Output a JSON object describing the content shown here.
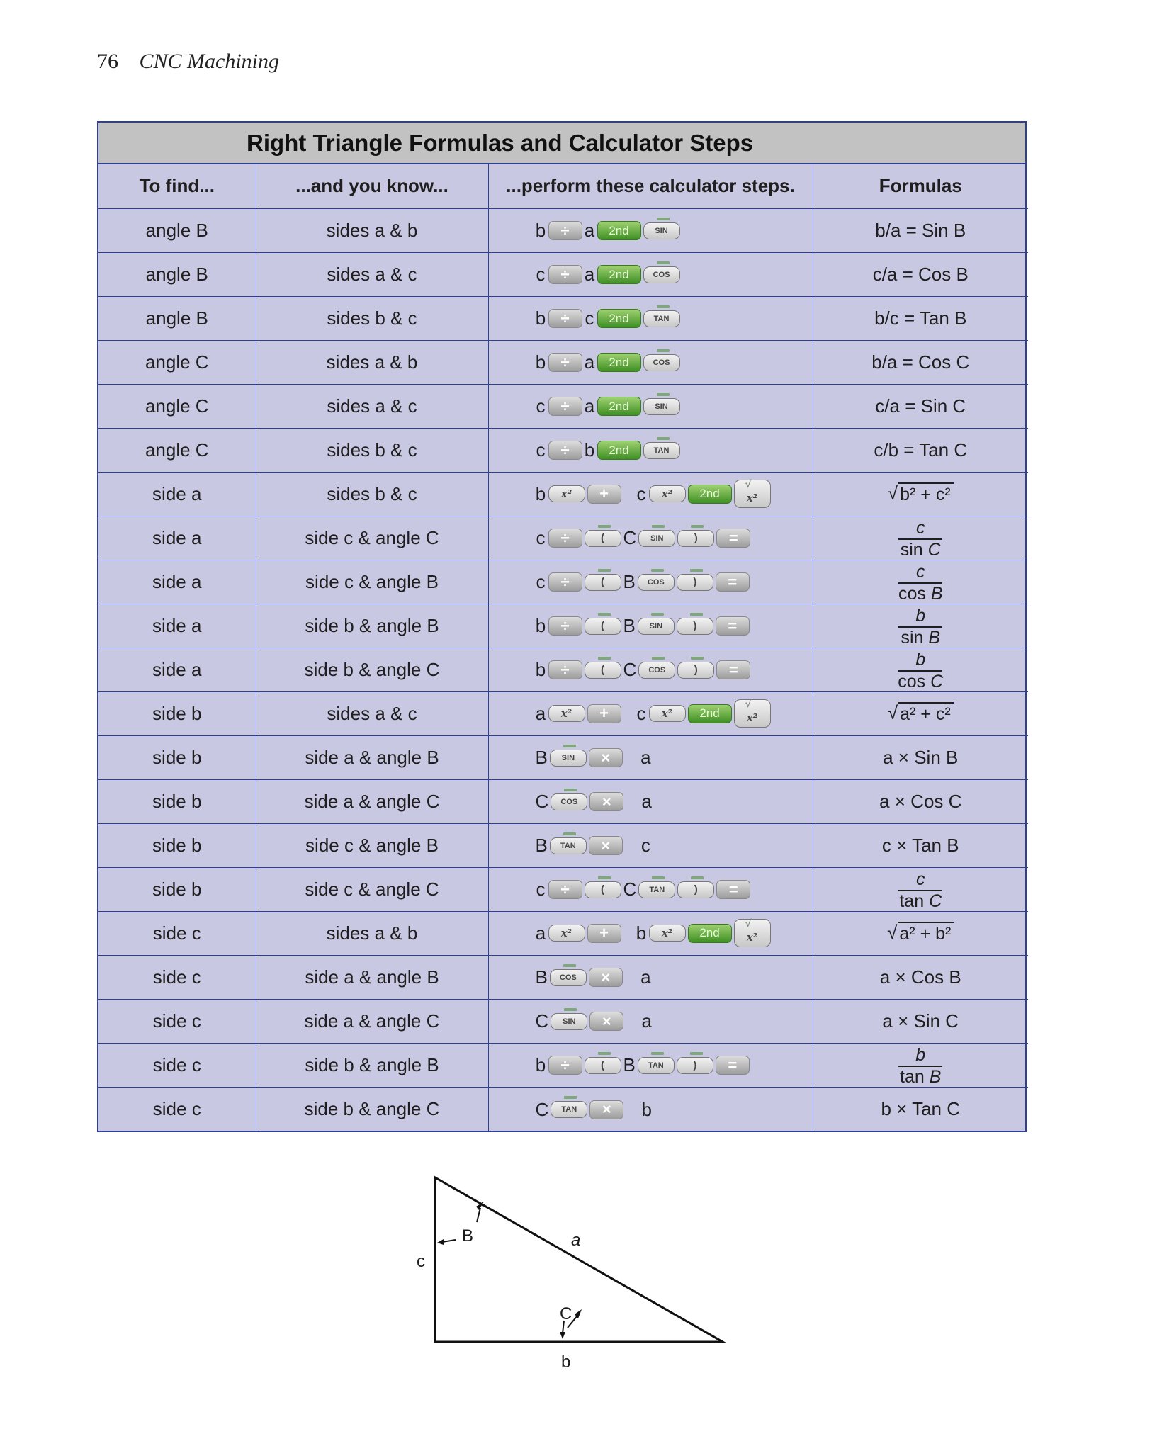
{
  "running_head": {
    "page_number": "76",
    "book_title": "CNC Machining"
  },
  "table": {
    "title": "Right Triangle Formulas and Calculator Steps",
    "headers": [
      "To find...",
      "...and you know...",
      "...perform these calculator steps.",
      "Formulas"
    ],
    "rows": [
      {
        "find": "angle B",
        "know": "sides a & b",
        "steps": [
          [
            "t",
            "b"
          ],
          [
            "div",
            "÷"
          ],
          [
            "t",
            "a"
          ],
          [
            "2nd",
            "2nd"
          ],
          [
            "fn",
            "SIN"
          ]
        ],
        "formula": {
          "type": "text",
          "text": "b/a = Sin B"
        }
      },
      {
        "find": "angle B",
        "know": "sides a & c",
        "steps": [
          [
            "t",
            "c"
          ],
          [
            "div",
            "÷"
          ],
          [
            "t",
            "a"
          ],
          [
            "2nd",
            "2nd"
          ],
          [
            "fn",
            "COS"
          ]
        ],
        "formula": {
          "type": "text",
          "text": "c/a = Cos B"
        }
      },
      {
        "find": "angle B",
        "know": "sides b & c",
        "steps": [
          [
            "t",
            "b"
          ],
          [
            "div",
            "÷"
          ],
          [
            "t",
            "c"
          ],
          [
            "2nd",
            "2nd"
          ],
          [
            "fn",
            "TAN"
          ]
        ],
        "formula": {
          "type": "text",
          "text": "b/c = Tan B"
        }
      },
      {
        "find": "angle C",
        "know": "sides a & b",
        "steps": [
          [
            "t",
            "b"
          ],
          [
            "div",
            "÷"
          ],
          [
            "t",
            "a"
          ],
          [
            "2nd",
            "2nd"
          ],
          [
            "fn",
            "COS"
          ]
        ],
        "formula": {
          "type": "text",
          "text": "b/a = Cos C"
        }
      },
      {
        "find": "angle C",
        "know": "sides a & c",
        "steps": [
          [
            "t",
            "c"
          ],
          [
            "div",
            "÷"
          ],
          [
            "t",
            "a"
          ],
          [
            "2nd",
            "2nd"
          ],
          [
            "fn",
            "SIN"
          ]
        ],
        "formula": {
          "type": "text",
          "text": "c/a = Sin C"
        }
      },
      {
        "find": "angle C",
        "know": "sides b & c",
        "steps": [
          [
            "t",
            "c"
          ],
          [
            "div",
            "÷"
          ],
          [
            "t",
            "b"
          ],
          [
            "2nd",
            "2nd"
          ],
          [
            "fn",
            "TAN"
          ]
        ],
        "formula": {
          "type": "text",
          "text": "c/b = Tan C"
        }
      },
      {
        "find": "side a",
        "know": "sides b & c",
        "steps": [
          [
            "t",
            "b"
          ],
          [
            "sq",
            "x²"
          ],
          [
            "plus",
            "+"
          ],
          [
            "t",
            "c"
          ],
          [
            "sq",
            "x²"
          ],
          [
            "2nd",
            "2nd"
          ],
          [
            "sqrtkey",
            "x²"
          ]
        ],
        "formula": {
          "type": "sqrt",
          "text": "b² + c²"
        }
      },
      {
        "find": "side a",
        "know": "side c & angle C",
        "steps": [
          [
            "t",
            "c"
          ],
          [
            "div",
            "÷"
          ],
          [
            "lp",
            "("
          ],
          [
            "t",
            "C"
          ],
          [
            "fn",
            "SIN"
          ],
          [
            "rp",
            ")"
          ],
          [
            "eq",
            "="
          ]
        ],
        "formula": {
          "type": "frac",
          "num": "c",
          "den_fn": "sin",
          "den_var": "C"
        }
      },
      {
        "find": "side a",
        "know": "side c & angle B",
        "steps": [
          [
            "t",
            "c"
          ],
          [
            "div",
            "÷"
          ],
          [
            "lp",
            "("
          ],
          [
            "t",
            "B"
          ],
          [
            "fn",
            "COS"
          ],
          [
            "rp",
            ")"
          ],
          [
            "eq",
            "="
          ]
        ],
        "formula": {
          "type": "frac",
          "num": "c",
          "den_fn": "cos",
          "den_var": "B"
        }
      },
      {
        "find": "side a",
        "know": "side b & angle B",
        "steps": [
          [
            "t",
            "b"
          ],
          [
            "div",
            "÷"
          ],
          [
            "lp",
            "("
          ],
          [
            "t",
            "B"
          ],
          [
            "fn",
            "SIN"
          ],
          [
            "rp",
            ")"
          ],
          [
            "eq",
            "="
          ]
        ],
        "formula": {
          "type": "frac",
          "num": "b",
          "den_fn": "sin",
          "den_var": "B"
        }
      },
      {
        "find": "side a",
        "know": "side b & angle C",
        "steps": [
          [
            "t",
            "b"
          ],
          [
            "div",
            "÷"
          ],
          [
            "lp",
            "("
          ],
          [
            "t",
            "C"
          ],
          [
            "fn",
            "COS"
          ],
          [
            "rp",
            ")"
          ],
          [
            "eq",
            "="
          ]
        ],
        "formula": {
          "type": "frac",
          "num": "b",
          "den_fn": "cos",
          "den_var": "C"
        }
      },
      {
        "find": "side b",
        "know": "sides a & c",
        "steps": [
          [
            "t",
            "a"
          ],
          [
            "sq",
            "x²"
          ],
          [
            "plus",
            "+"
          ],
          [
            "t",
            "c"
          ],
          [
            "sq",
            "x²"
          ],
          [
            "2nd",
            "2nd"
          ],
          [
            "sqrtkey",
            "x²"
          ]
        ],
        "formula": {
          "type": "sqrt",
          "text": "a² + c²"
        }
      },
      {
        "find": "side b",
        "know": "side a & angle B",
        "steps": [
          [
            "t",
            "B"
          ],
          [
            "fn",
            "SIN"
          ],
          [
            "mul",
            "×"
          ],
          [
            "t",
            "a"
          ]
        ],
        "formula": {
          "type": "text",
          "text": "a × Sin B"
        }
      },
      {
        "find": "side b",
        "know": "side a & angle C",
        "steps": [
          [
            "t",
            "C"
          ],
          [
            "fn",
            "COS"
          ],
          [
            "mul",
            "×"
          ],
          [
            "t",
            "a"
          ]
        ],
        "formula": {
          "type": "text",
          "text": "a × Cos C"
        }
      },
      {
        "find": "side b",
        "know": "side c & angle B",
        "steps": [
          [
            "t",
            "B"
          ],
          [
            "fn",
            "TAN"
          ],
          [
            "mul",
            "×"
          ],
          [
            "t",
            "c"
          ]
        ],
        "formula": {
          "type": "text",
          "text": "c × Tan B"
        }
      },
      {
        "find": "side b",
        "know": "side c & angle C",
        "steps": [
          [
            "t",
            "c"
          ],
          [
            "div",
            "÷"
          ],
          [
            "lp",
            "("
          ],
          [
            "t",
            "C"
          ],
          [
            "fn",
            "TAN"
          ],
          [
            "rp",
            ")"
          ],
          [
            "eq",
            "="
          ]
        ],
        "formula": {
          "type": "frac",
          "num": "c",
          "den_fn": "tan",
          "den_var": "C"
        }
      },
      {
        "find": "side c",
        "know": "sides a & b",
        "steps": [
          [
            "t",
            "a"
          ],
          [
            "sq",
            "x²"
          ],
          [
            "plus",
            "+"
          ],
          [
            "t",
            "b"
          ],
          [
            "sq",
            "x²"
          ],
          [
            "2nd",
            "2nd"
          ],
          [
            "sqrtkey",
            "x²"
          ]
        ],
        "formula": {
          "type": "sqrt",
          "text": "a² + b²"
        }
      },
      {
        "find": "side c",
        "know": "side a & angle B",
        "steps": [
          [
            "t",
            "B"
          ],
          [
            "fn",
            "COS"
          ],
          [
            "mul",
            "×"
          ],
          [
            "t",
            "a"
          ]
        ],
        "formula": {
          "type": "text",
          "text": "a × Cos B"
        }
      },
      {
        "find": "side c",
        "know": "side a & angle C",
        "steps": [
          [
            "t",
            "C"
          ],
          [
            "fn",
            "SIN"
          ],
          [
            "mul",
            "×"
          ],
          [
            "t",
            "a"
          ]
        ],
        "formula": {
          "type": "text",
          "text": "a × Sin C"
        }
      },
      {
        "find": "side c",
        "know": "side b & angle B",
        "steps": [
          [
            "t",
            "b"
          ],
          [
            "div",
            "÷"
          ],
          [
            "lp",
            "("
          ],
          [
            "t",
            "B"
          ],
          [
            "fn",
            "TAN"
          ],
          [
            "rp",
            ")"
          ],
          [
            "eq",
            "="
          ]
        ],
        "formula": {
          "type": "frac",
          "num": "b",
          "den_fn": "tan",
          "den_var": "B"
        }
      },
      {
        "find": "side c",
        "know": "side b & angle C",
        "steps": [
          [
            "t",
            "C"
          ],
          [
            "fn",
            "TAN"
          ],
          [
            "mul",
            "×"
          ],
          [
            "t",
            "b"
          ]
        ],
        "formula": {
          "type": "text",
          "text": "b × Tan C"
        }
      }
    ]
  },
  "diagram": {
    "labels": {
      "angle_top": "B",
      "angle_bottom": "C",
      "side_hyp": "a",
      "side_bottom": "b",
      "side_left": "c"
    }
  }
}
